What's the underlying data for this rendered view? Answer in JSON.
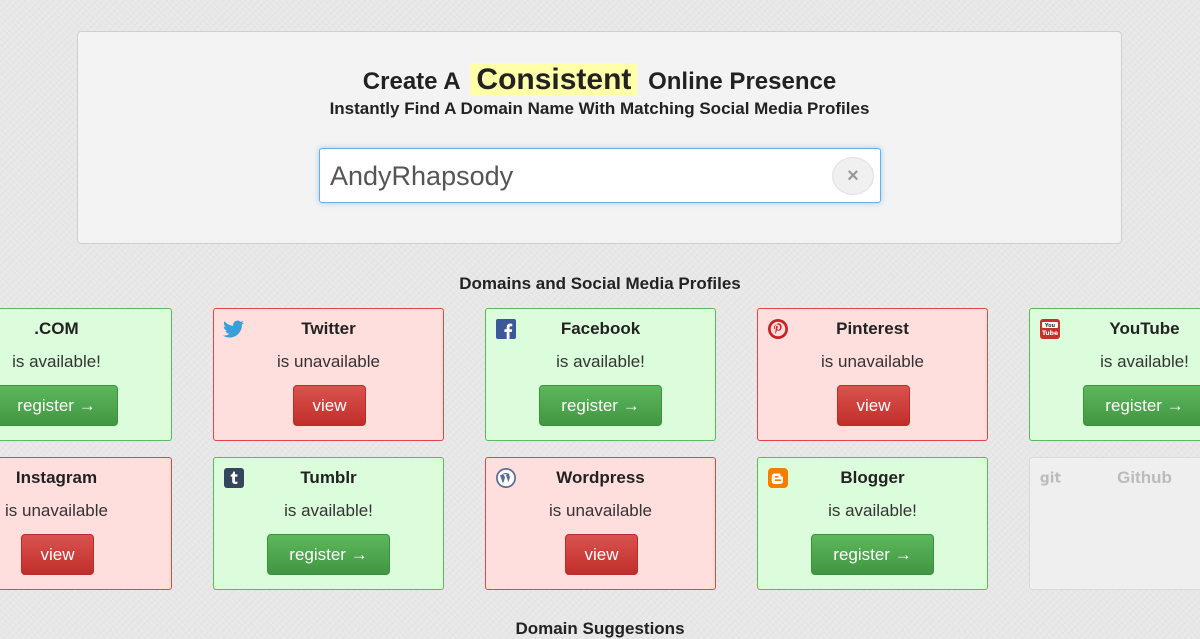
{
  "hero": {
    "title_before": "Create A",
    "title_highlight": "Consistent",
    "title_after": "Online Presence",
    "subtitle": "Instantly Find A Domain Name With Matching Social Media Profiles"
  },
  "search": {
    "value": "AndyRhapsody",
    "clear_label": "×"
  },
  "results_section_title": "Domains and Social Media Profiles",
  "suggestions_section_title": "Domain Suggestions",
  "status_labels": {
    "available": "is available!",
    "unavailable": "is unavailable"
  },
  "button_labels": {
    "register": "register →",
    "view": "view"
  },
  "cards": [
    {
      "name": ".COM",
      "status": "available",
      "icon": "none"
    },
    {
      "name": "Twitter",
      "status": "unavailable",
      "icon": "twitter-icon"
    },
    {
      "name": "Facebook",
      "status": "available",
      "icon": "facebook-icon"
    },
    {
      "name": "Pinterest",
      "status": "unavailable",
      "icon": "pinterest-icon"
    },
    {
      "name": "YouTube",
      "status": "available",
      "icon": "youtube-icon"
    },
    {
      "name": "Instagram",
      "status": "unavailable",
      "icon": "none"
    },
    {
      "name": "Tumblr",
      "status": "available",
      "icon": "tumblr-icon"
    },
    {
      "name": "Wordpress",
      "status": "unavailable",
      "icon": "wordpress-icon"
    },
    {
      "name": "Blogger",
      "status": "available",
      "icon": "blogger-icon"
    },
    {
      "name": "Github",
      "status": "pending",
      "icon": "git-icon"
    }
  ],
  "colors": {
    "available_bg": "#dcfddc",
    "unavailable_bg": "#ffdede",
    "register_button": "#5cb85c",
    "view_button": "#d9534f",
    "highlight": "#ffffaa"
  }
}
